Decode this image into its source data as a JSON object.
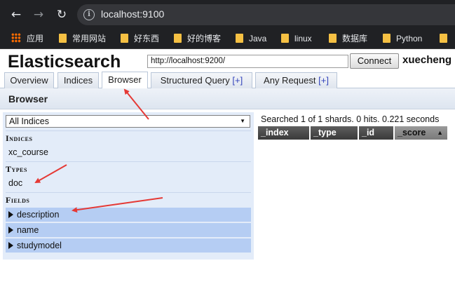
{
  "browser": {
    "url": "localhost:9100",
    "bookmarks": [
      "应用",
      "常用网站",
      "好东西",
      "好的博客",
      "Java",
      "linux",
      "数据库",
      "Python"
    ]
  },
  "es": {
    "title": "Elasticsearch",
    "connect_url": "http://localhost:9200/",
    "connect_label": "Connect",
    "cluster_name": "xuecheng",
    "tabs": [
      {
        "label": "Overview"
      },
      {
        "label": "Indices"
      },
      {
        "label": "Browser"
      },
      {
        "label": "Structured Query",
        "plus": "[+]"
      },
      {
        "label": "Any Request",
        "plus": "[+]"
      }
    ],
    "section_title": "Browser",
    "index_select": "All Indices",
    "headings": {
      "indices": "Indices",
      "types": "Types",
      "fields": "Fields"
    },
    "indices": [
      "xc_course"
    ],
    "types": [
      "doc"
    ],
    "fields": [
      "description",
      "name",
      "studymodel"
    ],
    "result_summary": "Searched 1 of 1 shards. 0 hits. 0.221 seconds",
    "columns": [
      "_index",
      "_type",
      "_id",
      "_score"
    ],
    "sort_indicator": "▲"
  },
  "colors": {
    "annotation": "#e53935",
    "field_highlight": "#b5cdf3",
    "panel": "#e3ecf9"
  }
}
